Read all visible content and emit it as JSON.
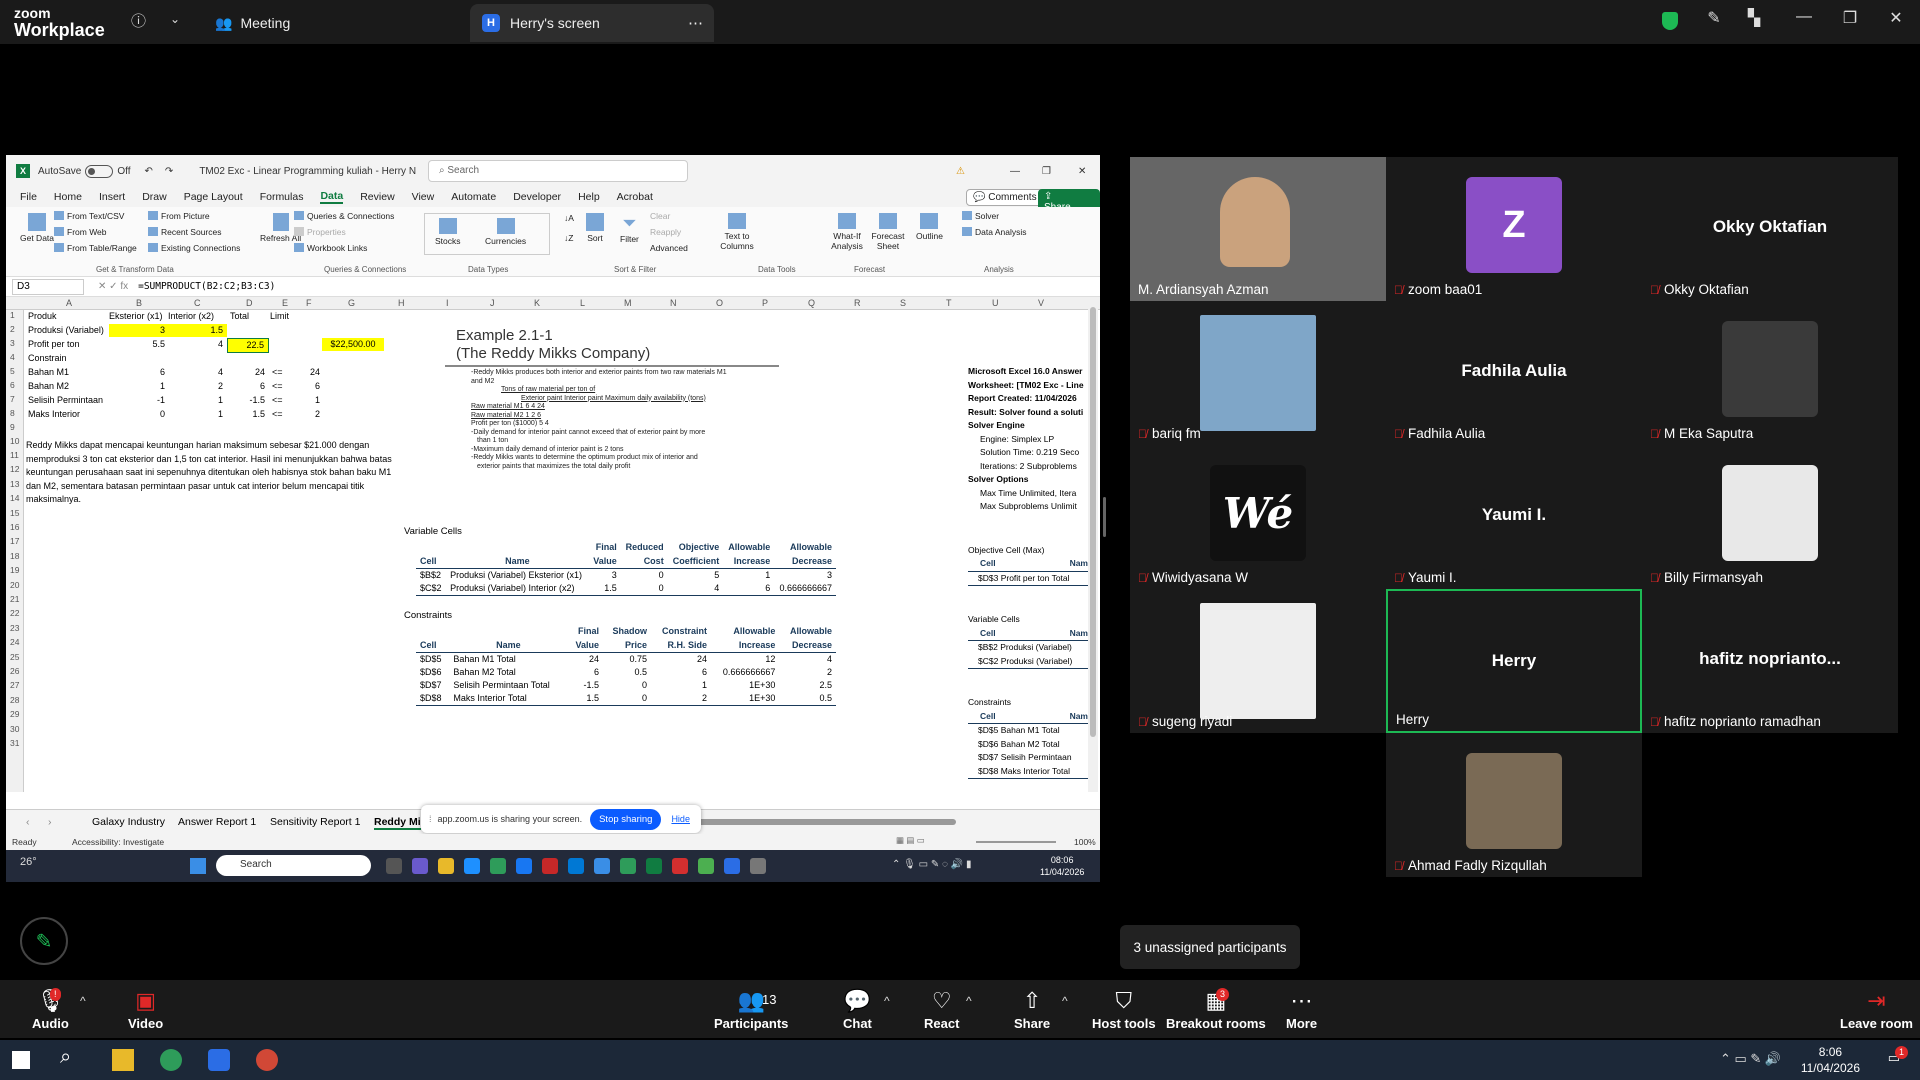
{
  "zoom_top": {
    "logo_line1": "zoom",
    "logo_line2": "Workplace",
    "meeting_tab": "Meeting",
    "screen_tab": "Herry's screen",
    "screen_badge": "H"
  },
  "excel": {
    "autosave": "AutoSave",
    "autosave_state": "Off",
    "file_title": "TM02 Exc - Linear Programming kuliah - Herry N",
    "search_placeholder": "Search",
    "menu": [
      "File",
      "Home",
      "Insert",
      "Draw",
      "Page Layout",
      "Formulas",
      "Data",
      "Review",
      "View",
      "Automate",
      "Developer",
      "Help",
      "Acrobat"
    ],
    "comments": "Comments",
    "share": "Share",
    "ribbon": {
      "get_data": "Get Data",
      "from_text": "From Text/CSV",
      "from_web": "From Web",
      "from_table": "From Table/Range",
      "from_picture": "From Picture",
      "recent_sources": "Recent Sources",
      "existing_connections": "Existing Connections",
      "group_get": "Get & Transform Data",
      "refresh": "Refresh All",
      "queries": "Queries & Connections",
      "properties": "Properties",
      "workbook_links": "Workbook Links",
      "group_queries": "Queries & Connections",
      "stocks": "Stocks",
      "currencies": "Currencies",
      "group_types": "Data Types",
      "sort": "Sort",
      "filter": "Filter",
      "clear": "Clear",
      "reapply": "Reapply",
      "advanced": "Advanced",
      "group_sort": "Sort & Filter",
      "text_to_columns": "Text to Columns",
      "group_tools": "Data Tools",
      "what_if": "What-If Analysis",
      "forecast_sheet": "Forecast Sheet",
      "group_forecast": "Forecast",
      "outline": "Outline",
      "solver": "Solver",
      "data_analysis": "Data Analysis",
      "group_analysis": "Analysis"
    },
    "namebox": "D3",
    "formula": "=SUMPRODUCT(B2:C2;B3:C3)",
    "columns": [
      "A",
      "B",
      "C",
      "D",
      "E",
      "F",
      "G",
      "H",
      "I",
      "J",
      "K",
      "L",
      "M",
      "N",
      "O",
      "P",
      "Q",
      "R",
      "S",
      "T",
      "U",
      "V"
    ],
    "rows": [
      "1",
      "2",
      "3",
      "4",
      "5",
      "6",
      "7",
      "8",
      "9",
      "10",
      "11",
      "12",
      "13",
      "14",
      "15",
      "16",
      "17",
      "18",
      "19",
      "20",
      "21",
      "22",
      "23",
      "24",
      "25",
      "26",
      "27",
      "28",
      "29",
      "30",
      "31"
    ],
    "cells": {
      "a1": "Produk",
      "b1": "Eksterior (x1)",
      "c1": "Interior (x2)",
      "d1": "Total",
      "e1": "Limit",
      "a2": "Produksi (Variabel)",
      "b2": "3",
      "c2": "1.5",
      "a3": "Profit per ton",
      "b3": "5.5",
      "c3": "4",
      "d3": "22.5",
      "g3": "$22,500.00",
      "a4": "Constrain",
      "a5": "Bahan M1",
      "b5": "6",
      "c5": "4",
      "d5": "24",
      "e5": "<=",
      "f5": "24",
      "a6": "Bahan M2",
      "b6": "1",
      "c6": "2",
      "d6": "6",
      "e6": "<=",
      "f6": "6",
      "a7": "Selisih Permintaan",
      "b7": "-1",
      "c7": "1",
      "d7": "-1.5",
      "e7": "<=",
      "f7": "1",
      "a8": "Maks Interior",
      "b8": "0",
      "c8": "1",
      "d8": "1.5",
      "e8": "<=",
      "f8": "2"
    },
    "paragraph": "Reddy Mikks dapat mencapai keuntungan harian maksimum sebesar $21.000 dengan memproduksi 3 ton cat eksterior dan 1,5 ton cat interior. Hasil ini menunjukkan bahwa batas keuntungan perusahaan saat ini sepenuhnya ditentukan oleh habisnya stok bahan baku M1 dan M2, sementara batasan permintaan pasar untuk cat interior belum mencapai titik maksimalnya.",
    "example_title1": "Example 2.1-1",
    "example_title2": "(The Reddy Mikks Company)",
    "example_lines": [
      "-Reddy Mikks produces both interior and exterior paints from two raw materials M1",
      "and M2",
      "Tons of raw material per ton of",
      "Exterior paint   Interior paint   Maximum daily availability (tons)",
      "Raw material M1      6        4        24",
      "Raw material M2      1        2        6",
      "Profit per ton ($1000)   5     4",
      "-Daily demand for interior paint cannot exceed that of exterior paint by more",
      "than 1 ton",
      "-Maximum daily demand of interior paint is 2 tons",
      "-Reddy Mikks wants to determine the optimum product mix of interior and",
      "exterior paints that maximizes the total daily profit"
    ],
    "var_label": "Variable Cells",
    "var_headers": [
      [
        "",
        "",
        "Final",
        "Reduced",
        "Objective",
        "Allowable",
        "Allowable"
      ],
      [
        "Cell",
        "Name",
        "Value",
        "Cost",
        "Coefficient",
        "Increase",
        "Decrease"
      ]
    ],
    "var_rows": [
      [
        "$B$2",
        "Produksi (Variabel) Eksterior (x1)",
        "3",
        "0",
        "5",
        "1",
        "3"
      ],
      [
        "$C$2",
        "Produksi (Variabel) Interior (x2)",
        "1.5",
        "0",
        "4",
        "6",
        "0.666666667"
      ]
    ],
    "con_label": "Constraints",
    "con_headers": [
      [
        "",
        "",
        "Final",
        "Shadow",
        "Constraint",
        "Allowable",
        "Allowable"
      ],
      [
        "Cell",
        "Name",
        "Value",
        "Price",
        "R.H. Side",
        "Increase",
        "Decrease"
      ]
    ],
    "con_rows": [
      [
        "$D$5",
        "Bahan M1 Total",
        "24",
        "0.75",
        "24",
        "12",
        "4"
      ],
      [
        "$D$6",
        "Bahan M2 Total",
        "6",
        "0.5",
        "6",
        "0.666666667",
        "2"
      ],
      [
        "$D$7",
        "Selisih Permintaan Total",
        "-1.5",
        "0",
        "1",
        "1E+30",
        "2.5"
      ],
      [
        "$D$8",
        "Maks Interior Total",
        "1.5",
        "0",
        "2",
        "1E+30",
        "0.5"
      ]
    ],
    "answer": {
      "l1": "Microsoft Excel 16.0 Answer",
      "l2": "Worksheet: [TM02 Exc - Line",
      "l3": "Report Created: 11/04/2026",
      "l4": "Result: Solver found a soluti",
      "l5": "Solver Engine",
      "l6": "Engine: Simplex LP",
      "l7": "Solution Time: 0.219 Seco",
      "l8": "Iterations: 2 Subproblems",
      "l9": "Solver Options",
      "l10": "Max Time Unlimited, Itera",
      "l11": "Max Subproblems Unlimit",
      "obj_label": "Objective Cell (Max)",
      "cell_h": "Cell",
      "nam_h": "Nam",
      "obj_cell": "$D$3",
      "obj_name": "Profit per ton Total",
      "var_label": "Variable Cells",
      "v1c": "$B$2",
      "v1n": "Produksi (Variabel)",
      "v2c": "$C$2",
      "v2n": "Produksi (Variabel)",
      "con_label": "Constraints",
      "c1c": "$D$5",
      "c1n": "Bahan M1 Total",
      "c2c": "$D$6",
      "c2n": "Bahan M2 Total",
      "c3c": "$D$7",
      "c3n": "Selisih Permintaan",
      "c4c": "$D$8",
      "c4n": "Maks Interior Total"
    },
    "sheet_tabs": [
      "Galaxy Industry",
      "Answer Report 1",
      "Sensitivity Report 1",
      "Reddy Mi"
    ],
    "share_notice": "app.zoom.us is sharing your screen.",
    "stop_sharing": "Stop sharing",
    "hide": "Hide",
    "status_ready": "Ready",
    "accessibility": "Accessibility: Investigate",
    "zoom_pct": "100%",
    "taskbar_search": "Search",
    "temp": "26°",
    "time": "08:06",
    "date": "11/04/2026"
  },
  "participants": [
    {
      "name": "M. Ardiansyah Azman",
      "type": "video"
    },
    {
      "name": "zoom baa01",
      "type": "letter",
      "letter": "Z"
    },
    {
      "name": "Okky Oktafian",
      "type": "text",
      "big": "Okky Oktafian"
    },
    {
      "name": "bariq fm",
      "type": "photo"
    },
    {
      "name": "Fadhila Aulia",
      "type": "text",
      "big": "Fadhila Aulia"
    },
    {
      "name": "M Eka Saputra",
      "type": "photo"
    },
    {
      "name": "Wiwidyasana W",
      "type": "logo",
      "logo": "Wé"
    },
    {
      "name": "Yaumi I.",
      "type": "text",
      "big": "Yaumi I."
    },
    {
      "name": "Billy Firmansyah",
      "type": "photo"
    },
    {
      "name": "sugeng riyadi",
      "type": "photo"
    },
    {
      "name": "Herry",
      "type": "text",
      "big": "Herry"
    },
    {
      "name": "hafitz noprianto ramadhan",
      "type": "text",
      "big": "hafitz  noprianto..."
    },
    {
      "name": "Ahmad Fadly Rizqullah",
      "type": "photo"
    }
  ],
  "unassigned": "3 unassigned participants",
  "bottom": {
    "audio": "Audio",
    "video": "Video",
    "participants": "Participants",
    "participants_count": "13",
    "chat": "Chat",
    "react": "React",
    "share": "Share",
    "host_tools": "Host tools",
    "breakout": "Breakout rooms",
    "breakout_badge": "3",
    "more": "More",
    "leave": "Leave room",
    "audio_badge": "!"
  },
  "win": {
    "time": "8:06",
    "date": "11/04/2026",
    "notif": "1"
  },
  "colors": {
    "accent_green": "#1db954",
    "zoom_blue": "#0b5cff",
    "excel_green": "#107c41",
    "mute_red": "#e02828"
  }
}
